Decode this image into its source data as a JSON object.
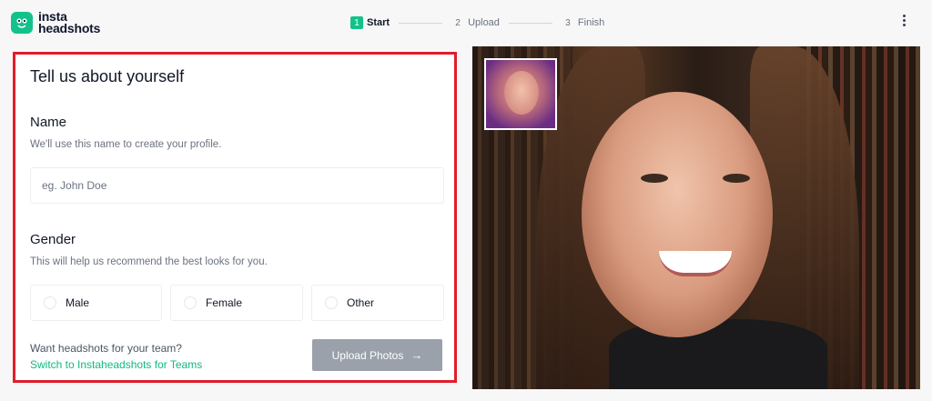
{
  "brand": {
    "line1": "insta",
    "line2": "headshots",
    "accent": "#13c28b"
  },
  "steps": [
    {
      "num": "1",
      "label": "Start",
      "active": true
    },
    {
      "num": "2",
      "label": "Upload",
      "active": false
    },
    {
      "num": "3",
      "label": "Finish",
      "active": false
    }
  ],
  "form": {
    "title": "Tell us about yourself",
    "name": {
      "label": "Name",
      "help": "We'll use this name to create your profile.",
      "placeholder": "eg. John Doe",
      "value": ""
    },
    "gender": {
      "label": "Gender",
      "help": "This will help us recommend the best looks for you.",
      "options": [
        "Male",
        "Female",
        "Other"
      ]
    },
    "team_question": "Want headshots for your team?",
    "team_link": "Switch to Instaheadshots for Teams",
    "upload_button": "Upload Photos"
  },
  "colors": {
    "highlight_border": "#e11d2a",
    "link": "#10b981",
    "button_disabled": "#9aa1aa"
  },
  "icons": {
    "menu": "kebab-menu-icon",
    "upload_arrow": "arrow-right-icon",
    "logo": "owl-logo-icon"
  }
}
